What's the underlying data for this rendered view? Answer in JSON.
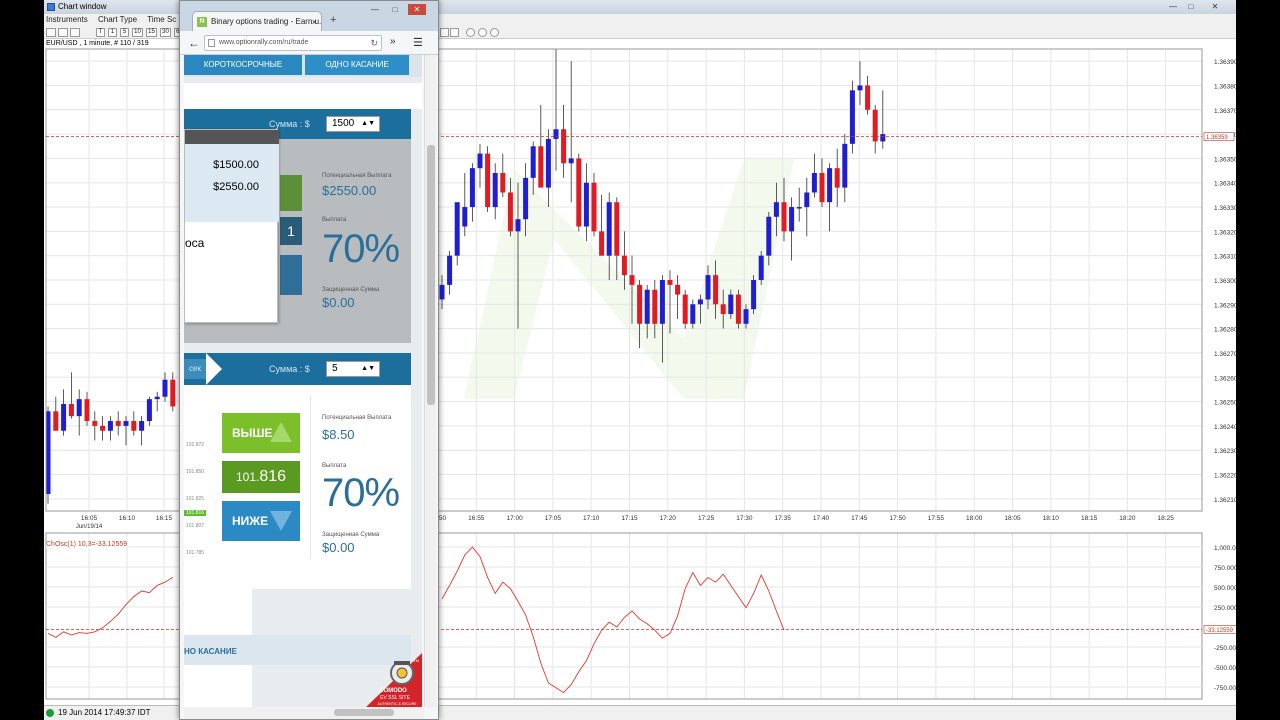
{
  "window": {
    "title": "Chart window"
  },
  "menu": [
    "Instruments",
    "Chart Type",
    "Time Sc"
  ],
  "toolbar": {
    "periods": [
      "T",
      "1",
      "5",
      "10",
      "15",
      "30",
      "60"
    ]
  },
  "symbol_label": "EUR/USD , 1 minute, # 110 / 319",
  "oscillator_label": "ChOsc(1) 10,3=-33.12559",
  "price_tag": "1.36359",
  "osc_tag": "-33.12559",
  "status": {
    "datetime": "19 Jun 2014 17:49:37 IDT"
  },
  "chart_data": [
    {
      "type": "candlestick",
      "title": "EUR/USD , 1 minute, # 110 / 319",
      "x_ticks": [
        "16:05",
        "16:10",
        "16:15",
        "16:50",
        "16:55",
        "17:00",
        "17:05",
        "17:10",
        "17:15",
        "17:20",
        "17:25",
        "17:30",
        "17:35",
        "17:40",
        "17:45",
        "17:50",
        "17:55",
        "18:00",
        "18:05",
        "18:10",
        "18:15",
        "18:20",
        "18:25"
      ],
      "x_date_label": "Jun/19/14",
      "y_ticks": [
        "1.36390",
        "1.36380",
        "1.36370",
        "1.36360",
        "1.36350",
        "1.36340",
        "1.36330",
        "1.36320",
        "1.36310",
        "1.36300",
        "1.36290",
        "1.36280",
        "1.36270",
        "1.36260",
        "1.36250",
        "1.36240",
        "1.36230",
        "1.36220",
        "1.36210"
      ],
      "y_range": [
        1.36205,
        1.36395
      ],
      "reference_line": 1.36359,
      "candles": [
        {
          "o": 1.36212,
          "h": 1.36248,
          "l": 1.36208,
          "c": 1.36246
        },
        {
          "o": 1.36246,
          "h": 1.36252,
          "l": 1.36238,
          "c": 1.36238
        },
        {
          "o": 1.36238,
          "h": 1.36255,
          "l": 1.36236,
          "c": 1.36249
        },
        {
          "o": 1.36249,
          "h": 1.36262,
          "l": 1.36243,
          "c": 1.36244
        },
        {
          "o": 1.36244,
          "h": 1.36255,
          "l": 1.36236,
          "c": 1.36251
        },
        {
          "o": 1.36251,
          "h": 1.36254,
          "l": 1.3624,
          "c": 1.36242
        },
        {
          "o": 1.36242,
          "h": 1.36246,
          "l": 1.36234,
          "c": 1.3624
        },
        {
          "o": 1.3624,
          "h": 1.36244,
          "l": 1.36234,
          "c": 1.36238
        },
        {
          "o": 1.36238,
          "h": 1.36244,
          "l": 1.36234,
          "c": 1.36242
        },
        {
          "o": 1.36242,
          "h": 1.36246,
          "l": 1.36236,
          "c": 1.3624
        },
        {
          "o": 1.3624,
          "h": 1.36244,
          "l": 1.36232,
          "c": 1.36242
        },
        {
          "o": 1.36242,
          "h": 1.36246,
          "l": 1.36236,
          "c": 1.36238
        },
        {
          "o": 1.36238,
          "h": 1.36244,
          "l": 1.36232,
          "c": 1.36242
        },
        {
          "o": 1.36242,
          "h": 1.36252,
          "l": 1.3624,
          "c": 1.36251
        },
        {
          "o": 1.36251,
          "h": 1.36254,
          "l": 1.36246,
          "c": 1.36252
        },
        {
          "o": 1.36252,
          "h": 1.36262,
          "l": 1.3625,
          "c": 1.36259
        },
        {
          "o": 1.36259,
          "h": 1.36262,
          "l": 1.36246,
          "c": 1.36248
        },
        {
          "o": 1.36292,
          "h": 1.36302,
          "l": 1.36288,
          "c": 1.36298
        },
        {
          "o": 1.36298,
          "h": 1.36312,
          "l": 1.36294,
          "c": 1.3631
        },
        {
          "o": 1.3631,
          "h": 1.3633,
          "l": 1.36306,
          "c": 1.36332
        },
        {
          "o": 1.36322,
          "h": 1.36344,
          "l": 1.36318,
          "c": 1.3633
        },
        {
          "o": 1.3633,
          "h": 1.36348,
          "l": 1.36324,
          "c": 1.36346
        },
        {
          "o": 1.36346,
          "h": 1.36356,
          "l": 1.36338,
          "c": 1.36352
        },
        {
          "o": 1.36352,
          "h": 1.36355,
          "l": 1.36328,
          "c": 1.3633
        },
        {
          "o": 1.3633,
          "h": 1.36348,
          "l": 1.36325,
          "c": 1.36344
        },
        {
          "o": 1.36344,
          "h": 1.36352,
          "l": 1.36334,
          "c": 1.36336
        },
        {
          "o": 1.36336,
          "h": 1.36342,
          "l": 1.36318,
          "c": 1.3632
        },
        {
          "o": 1.3632,
          "h": 1.3634,
          "l": 1.3628,
          "c": 1.36325
        },
        {
          "o": 1.36325,
          "h": 1.36348,
          "l": 1.36318,
          "c": 1.36342
        },
        {
          "o": 1.36342,
          "h": 1.36357,
          "l": 1.36335,
          "c": 1.36355
        },
        {
          "o": 1.36355,
          "h": 1.36372,
          "l": 1.3635,
          "c": 1.36338
        },
        {
          "o": 1.36338,
          "h": 1.36362,
          "l": 1.3633,
          "c": 1.36358
        },
        {
          "o": 1.36358,
          "h": 1.36395,
          "l": 1.36345,
          "c": 1.36362
        },
        {
          "o": 1.36362,
          "h": 1.36372,
          "l": 1.36342,
          "c": 1.36348
        },
        {
          "o": 1.36348,
          "h": 1.3639,
          "l": 1.36332,
          "c": 1.3635
        },
        {
          "o": 1.3635,
          "h": 1.36352,
          "l": 1.3632,
          "c": 1.36322
        },
        {
          "o": 1.36322,
          "h": 1.36348,
          "l": 1.36316,
          "c": 1.3634
        },
        {
          "o": 1.3634,
          "h": 1.36344,
          "l": 1.36318,
          "c": 1.3632
        },
        {
          "o": 1.3632,
          "h": 1.36335,
          "l": 1.3631,
          "c": 1.3631
        },
        {
          "o": 1.3631,
          "h": 1.36336,
          "l": 1.363,
          "c": 1.36332
        },
        {
          "o": 1.36332,
          "h": 1.36334,
          "l": 1.363,
          "c": 1.3631
        },
        {
          "o": 1.3631,
          "h": 1.3632,
          "l": 1.36296,
          "c": 1.36302
        },
        {
          "o": 1.36302,
          "h": 1.3631,
          "l": 1.36282,
          "c": 1.36298
        },
        {
          "o": 1.36298,
          "h": 1.363,
          "l": 1.36272,
          "c": 1.36282
        },
        {
          "o": 1.36282,
          "h": 1.36298,
          "l": 1.36276,
          "c": 1.36296
        },
        {
          "o": 1.36296,
          "h": 1.363,
          "l": 1.36276,
          "c": 1.36282
        },
        {
          "o": 1.36282,
          "h": 1.36302,
          "l": 1.36266,
          "c": 1.363
        },
        {
          "o": 1.363,
          "h": 1.36304,
          "l": 1.36278,
          "c": 1.36298
        },
        {
          "o": 1.36298,
          "h": 1.36302,
          "l": 1.36284,
          "c": 1.36294
        },
        {
          "o": 1.36294,
          "h": 1.36296,
          "l": 1.3628,
          "c": 1.36282
        },
        {
          "o": 1.36282,
          "h": 1.36292,
          "l": 1.3628,
          "c": 1.3629
        },
        {
          "o": 1.3629,
          "h": 1.36294,
          "l": 1.36282,
          "c": 1.36292
        },
        {
          "o": 1.36292,
          "h": 1.36306,
          "l": 1.36288,
          "c": 1.36302
        },
        {
          "o": 1.36302,
          "h": 1.36308,
          "l": 1.36284,
          "c": 1.3629
        },
        {
          "o": 1.3629,
          "h": 1.36296,
          "l": 1.3628,
          "c": 1.36286
        },
        {
          "o": 1.36286,
          "h": 1.36296,
          "l": 1.36284,
          "c": 1.36294
        },
        {
          "o": 1.36294,
          "h": 1.36296,
          "l": 1.3628,
          "c": 1.36282
        },
        {
          "o": 1.36282,
          "h": 1.3629,
          "l": 1.3628,
          "c": 1.36288
        },
        {
          "o": 1.36288,
          "h": 1.36302,
          "l": 1.36286,
          "c": 1.363
        },
        {
          "o": 1.363,
          "h": 1.36312,
          "l": 1.36298,
          "c": 1.3631
        },
        {
          "o": 1.3631,
          "h": 1.36328,
          "l": 1.36306,
          "c": 1.36326
        },
        {
          "o": 1.36326,
          "h": 1.3634,
          "l": 1.36318,
          "c": 1.36332
        },
        {
          "o": 1.36332,
          "h": 1.36342,
          "l": 1.36316,
          "c": 1.3632
        },
        {
          "o": 1.3632,
          "h": 1.36334,
          "l": 1.36308,
          "c": 1.3633
        },
        {
          "o": 1.3633,
          "h": 1.36338,
          "l": 1.36324,
          "c": 1.3633
        },
        {
          "o": 1.3633,
          "h": 1.36342,
          "l": 1.36318,
          "c": 1.36336
        },
        {
          "o": 1.36336,
          "h": 1.36352,
          "l": 1.36334,
          "c": 1.36344
        },
        {
          "o": 1.36344,
          "h": 1.3635,
          "l": 1.3633,
          "c": 1.36332
        },
        {
          "o": 1.36332,
          "h": 1.36348,
          "l": 1.3632,
          "c": 1.36346
        },
        {
          "o": 1.36346,
          "h": 1.36354,
          "l": 1.3633,
          "c": 1.36338
        },
        {
          "o": 1.36338,
          "h": 1.3636,
          "l": 1.36332,
          "c": 1.36356
        },
        {
          "o": 1.36356,
          "h": 1.36382,
          "l": 1.36352,
          "c": 1.36378
        },
        {
          "o": 1.36378,
          "h": 1.3639,
          "l": 1.36372,
          "c": 1.3638
        },
        {
          "o": 1.3638,
          "h": 1.36384,
          "l": 1.36368,
          "c": 1.3637
        },
        {
          "o": 1.3637,
          "h": 1.36372,
          "l": 1.36352,
          "c": 1.36357
        },
        {
          "o": 1.36357,
          "h": 1.36378,
          "l": 1.36354,
          "c": 1.3636
        }
      ],
      "colors": {
        "up": "#1f1fd1",
        "down": "#e21b22"
      }
    },
    {
      "type": "line",
      "title": "ChOsc(1) 10,3=-33.12559",
      "y_ticks": [
        "1,000.0000",
        "750.0000",
        "500.0000",
        "250.0000",
        "-250.0000",
        "-500.0000",
        "-750.0000"
      ],
      "y_range": [
        -900,
        1100
      ],
      "reference_line": -33.12559,
      "color": "#e03a2a",
      "values": [
        -80,
        -130,
        -60,
        -100,
        -70,
        -80,
        -60,
        -10,
        70,
        160,
        280,
        380,
        450,
        430,
        520,
        560,
        620,
        -1,
        350,
        520,
        700,
        900,
        1000,
        880,
        620,
        420,
        560,
        480,
        320,
        150,
        -120,
        -450,
        -700,
        -760,
        -820,
        -720,
        -560,
        -420,
        -210,
        -40,
        60,
        0,
        120,
        200,
        100,
        40,
        -40,
        -140,
        -80,
        140,
        480,
        680,
        520,
        620,
        560,
        660,
        520,
        380,
        240,
        420,
        650,
        450,
        200,
        -40
      ]
    }
  ],
  "browser": {
    "tab_title": "Binary options trading - Earn u...",
    "favicon": "N",
    "url": "www.optionrally.com/ru/trade",
    "tabs": [
      "КОРОТКОСРОЧНЫЕ",
      "ОДНО КАСАНИЕ"
    ],
    "panel1": {
      "sum_label": "Сумма : $",
      "sum_value": "1500",
      "pot_label": "Потенциальная Выплата",
      "pot_value": "$2550.00",
      "pay_label": "Выплата",
      "pay_value": "70%",
      "prot_label": "Защищенная Сумма",
      "prot_value": "$0.00",
      "price_digit": "1"
    },
    "popup": {
      "line1": "$1500.00",
      "line2": "$2550.00",
      "word": "оса"
    },
    "panel2": {
      "time_label": "сек",
      "sum_label": "Сумма : $",
      "sum_value": "5",
      "up_label": "ВЫШЕ",
      "down_label": "НИЖЕ",
      "price_small": "101.",
      "price_big": "816",
      "pot_label": "Потенциальная Выплата",
      "pot_value": "$8.50",
      "pay_label": "Выплата",
      "pay_value": "70%",
      "prot_label": "Защищенная Сумма",
      "prot_value": "$0.00",
      "scale": [
        "101.872",
        "101.850",
        "101.825",
        "101.816",
        "101.807",
        "101.785"
      ]
    },
    "bottom_tab": "НО КАСАНИЕ",
    "badge": {
      "brand": "COMODO",
      "line1": "EV SSL SITE",
      "line2": "AUTHENTIC & SECURE",
      "tm": "TM"
    }
  }
}
